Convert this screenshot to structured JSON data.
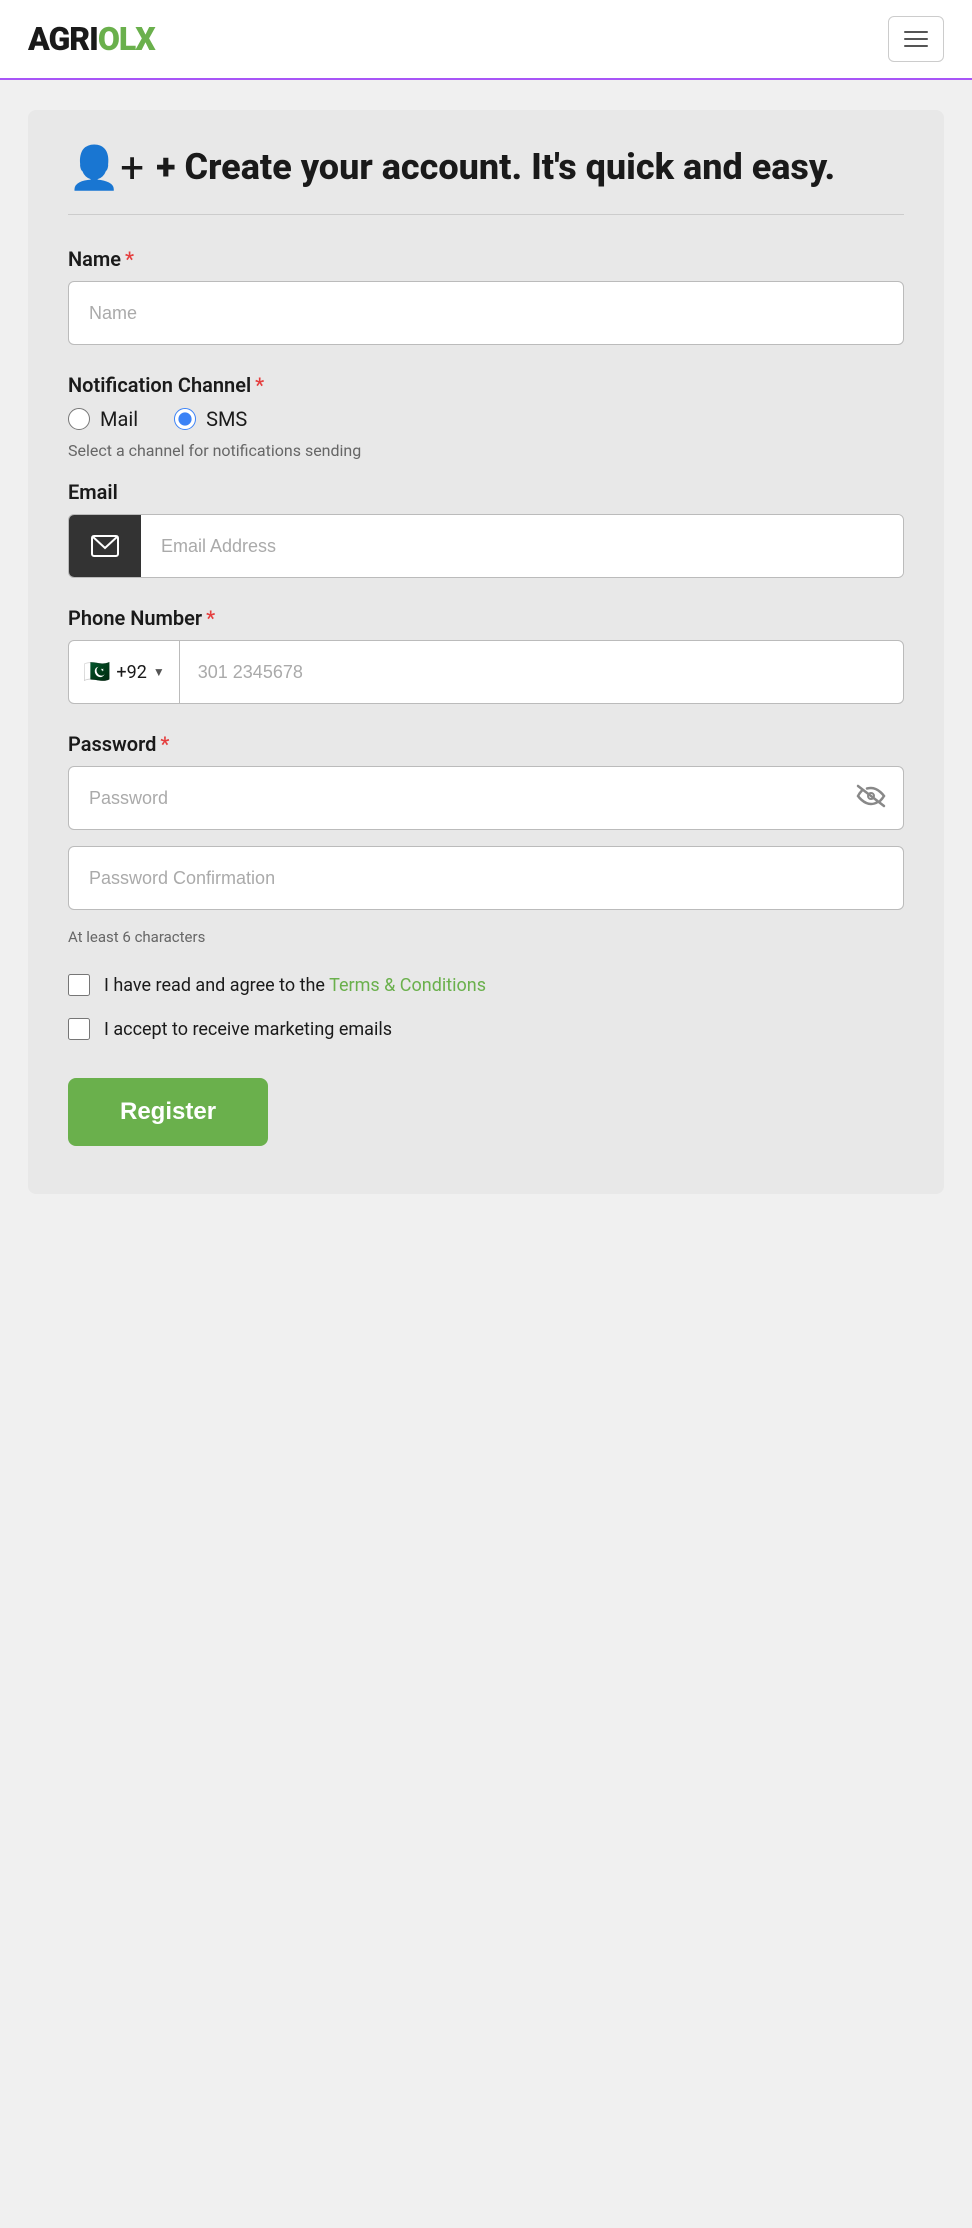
{
  "navbar": {
    "logo_black": "AGRI",
    "logo_green": "OLX",
    "hamburger_label": "Toggle navigation"
  },
  "form": {
    "title": "+ Create your account. It's quick and easy.",
    "name_label": "Name",
    "name_placeholder": "Name",
    "notification_label": "Notification Channel",
    "notification_options": [
      {
        "id": "mail",
        "label": "Mail",
        "checked": false
      },
      {
        "id": "sms",
        "label": "SMS",
        "checked": true
      }
    ],
    "notification_hint": "Select a channel for notifications sending",
    "email_label": "Email",
    "email_placeholder": "Email Address",
    "phone_label": "Phone Number",
    "phone_flag": "🇵🇰",
    "phone_code": "+92",
    "phone_placeholder": "301 2345678",
    "password_label": "Password",
    "password_placeholder": "Password",
    "password_confirm_placeholder": "Password Confirmation",
    "password_hint": "At least 6 characters",
    "terms_text": "I have read and agree to the ",
    "terms_link_text": "Terms & Conditions",
    "marketing_text": "I accept to receive marketing emails",
    "register_label": "Register"
  }
}
